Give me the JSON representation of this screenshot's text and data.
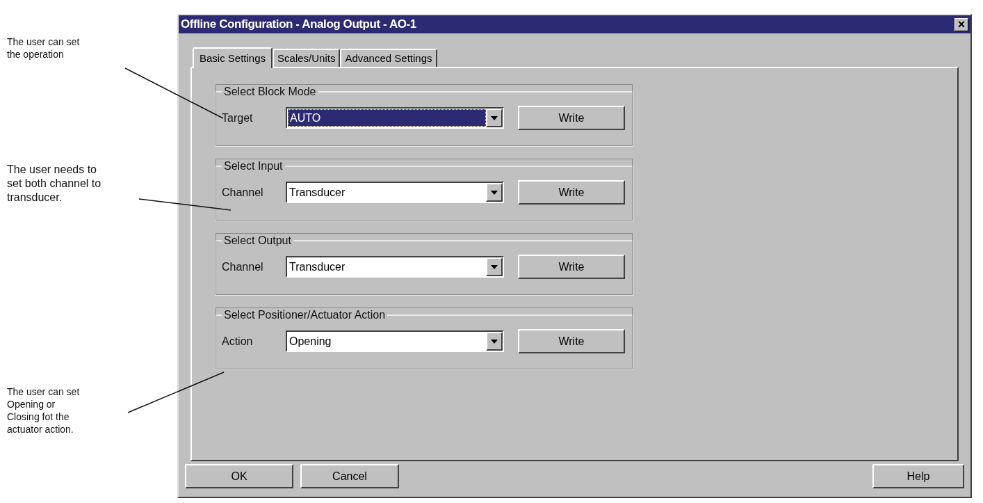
{
  "annotations": [
    {
      "text": "The user can set the operation"
    },
    {
      "text": "The user needs to set both channel to transducer."
    },
    {
      "text": "The user can set Opening or Closing fot the actuator action."
    }
  ],
  "window": {
    "title": "Offline Configuration - Analog Output - AO-1",
    "close": "×"
  },
  "tabs": [
    {
      "label": "Basic Settings",
      "selected": true
    },
    {
      "label": "Scales/Units",
      "selected": false
    },
    {
      "label": "Advanced Settings",
      "selected": false
    }
  ],
  "groups": [
    {
      "title": "Select Block Mode",
      "label": "Target",
      "value": "AUTO",
      "focused": true,
      "button": "Write"
    },
    {
      "title": "Select Input",
      "label": "Channel",
      "value": "Transducer",
      "focused": false,
      "button": "Write"
    },
    {
      "title": "Select Output",
      "label": "Channel",
      "value": "Transducer",
      "focused": false,
      "button": "Write"
    },
    {
      "title": "Select Positioner/Actuator Action",
      "label": "Action",
      "value": "Opening",
      "focused": false,
      "button": "Write"
    }
  ],
  "buttons": [
    "OK",
    "Cancel",
    "Help"
  ]
}
